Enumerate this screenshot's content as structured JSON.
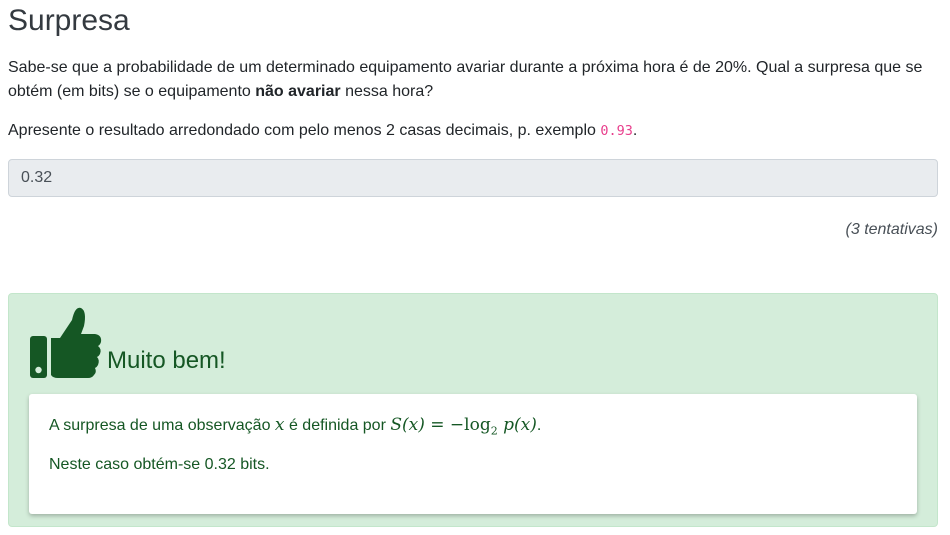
{
  "title": "Surpresa",
  "question": {
    "part1": "Sabe-se que a probabilidade de um determinado equipamento avariar durante a próxima hora é de 20%. Qual a surpresa que se obtém (em bits) se o equipamento ",
    "bold": "não avariar",
    "part2": " nessa hora?"
  },
  "instruction": {
    "text": "Apresente o resultado arredondado com pelo menos 2 casas decimais, p. exemplo ",
    "example": "0.93",
    "end": "."
  },
  "answer": {
    "value": "0.32"
  },
  "attempts": "(3 tentativas)",
  "feedback": {
    "icon": "thumbs-up-icon",
    "title": "Muito bem!",
    "colors": {
      "background": "#d4edda",
      "text": "#155724",
      "icon": "#155724"
    },
    "line1": {
      "before": "A surpresa de uma observação ",
      "var": "x",
      "middle": " é definida por ",
      "formula_lhs": "S(x)",
      "formula_eq": " = −",
      "formula_log": "log",
      "formula_sub": "2",
      "formula_rhs": " p(x)",
      "end": "."
    },
    "line2": "Neste caso obtém-se 0.32 bits."
  }
}
